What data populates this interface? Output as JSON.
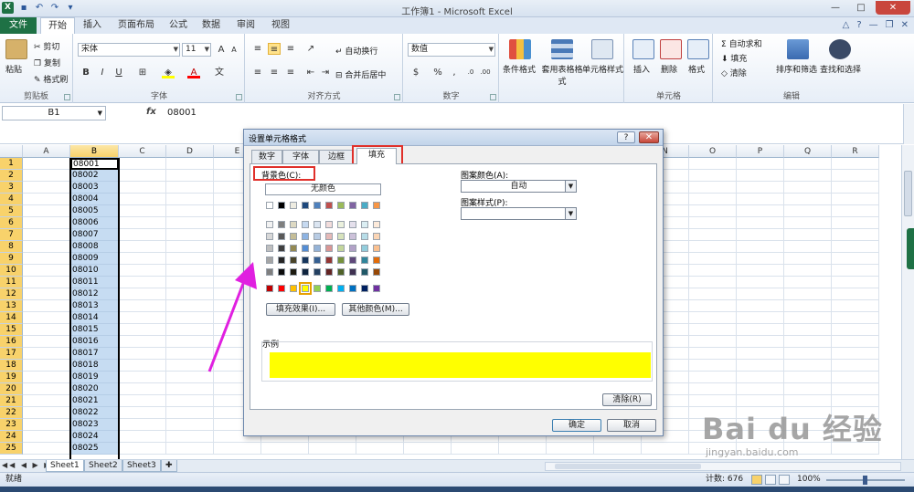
{
  "titlebar": {
    "title": "工作簿1 - Microsoft Excel",
    "app_icon": "X",
    "buttons": [
      "—",
      "□",
      "✕"
    ]
  },
  "ribbon_tabs": {
    "file": "文件",
    "tabs": [
      "开始",
      "插入",
      "页面布局",
      "公式",
      "数据",
      "审阅",
      "视图"
    ]
  },
  "ribbon": {
    "clipboard": {
      "paste": "粘贴",
      "cut": "剪切",
      "copy": "复制",
      "format_painter": "格式刷",
      "label": "剪贴板"
    },
    "font": {
      "font_name": "宋体",
      "font_size": "11",
      "bold": "B",
      "italic": "I",
      "underline": "U",
      "label": "字体"
    },
    "alignment": {
      "wrap": "自动换行",
      "merge": "合并后居中",
      "label": "对齐方式"
    },
    "number": {
      "format": "数值",
      "percent": "%",
      "comma": ",",
      "label": "数字"
    },
    "styles": {
      "conditional": "条件格式",
      "table": "套用表格格式",
      "cell_styles": "单元格样式"
    },
    "cells": {
      "insert": "插入",
      "delete": "删除",
      "format": "格式",
      "label": "单元格"
    },
    "editing": {
      "autosum": "自动求和",
      "fill": "填充",
      "clear": "清除",
      "sort": "排序和筛选",
      "find": "查找和选择",
      "label": "编辑"
    }
  },
  "formula_bar": {
    "name_box": "B1",
    "fx": "fx",
    "value": "08001"
  },
  "grid": {
    "columns": [
      "A",
      "B",
      "C",
      "D",
      "E",
      "F",
      "G",
      "H",
      "I",
      "J",
      "K",
      "L",
      "M",
      "N",
      "O",
      "P",
      "Q",
      "R"
    ],
    "selected_column": "B",
    "rows": [
      "1",
      "2",
      "3",
      "4",
      "5",
      "6",
      "7",
      "8",
      "9",
      "10",
      "11",
      "12",
      "13",
      "14",
      "15",
      "16",
      "17",
      "18",
      "19",
      "20",
      "21",
      "22",
      "23",
      "24",
      "25"
    ],
    "b_values": [
      "08001",
      "08002",
      "08003",
      "08004",
      "08005",
      "08006",
      "08007",
      "08008",
      "08009",
      "08010",
      "08011",
      "08012",
      "08013",
      "08014",
      "08015",
      "08016",
      "08017",
      "08018",
      "08019",
      "08020",
      "08021",
      "08022",
      "08023",
      "08024",
      "08025"
    ]
  },
  "sheets": {
    "tabs": [
      "Sheet1",
      "Sheet2",
      "Sheet3"
    ],
    "active": "Sheet1",
    "nav": "◀◀ ◀ ▶ ▶▶"
  },
  "status": {
    "ready": "就绪",
    "count": "计数: 676",
    "zoom": "100%"
  },
  "dialog": {
    "title": "设置单元格格式",
    "help": "?",
    "close": "✕",
    "tabs": [
      "数字",
      "字体",
      "边框",
      "填充"
    ],
    "active_tab": "填充",
    "background_label": "背景色(C):",
    "no_color": "无颜色",
    "fill_effects": "填充效果(I)...",
    "more_colors": "其他颜色(M)...",
    "pattern_color_label": "图案颜色(A):",
    "pattern_color_value": "自动",
    "pattern_style_label": "图案样式(P):",
    "pattern_style_value": "",
    "sample_label": "示例",
    "clear": "清除(R)",
    "ok": "确定",
    "cancel": "取消",
    "sample_color": "#ffff00",
    "palette_top": [
      "#ffffff",
      "#000000",
      "#eeece1",
      "#1f497d",
      "#4f81bd",
      "#c0504d",
      "#9bbb59",
      "#8064a2",
      "#4bacc6",
      "#f79646"
    ],
    "palette_tints": [
      [
        "#f2f2f2",
        "#7f7f7f",
        "#ddd9c3",
        "#c6d9f0",
        "#dbe5f1",
        "#f2dcdb",
        "#ebf1dd",
        "#e5e0ec",
        "#dbeef3",
        "#fdeada"
      ],
      [
        "#d8d8d8",
        "#595959",
        "#c4bd97",
        "#8db3e2",
        "#b8cce4",
        "#e5b9b7",
        "#d7e3bc",
        "#ccc1d9",
        "#b7dde8",
        "#fbd5b5"
      ],
      [
        "#bfbfbf",
        "#3f3f3f",
        "#938953",
        "#548dd4",
        "#95b3d7",
        "#d99694",
        "#c3d69b",
        "#b2a2c7",
        "#92cddc",
        "#fac08f"
      ],
      [
        "#a5a5a5",
        "#262626",
        "#494429",
        "#17365d",
        "#366092",
        "#953734",
        "#76923c",
        "#5f497a",
        "#31859b",
        "#e36c09"
      ],
      [
        "#7f7f7f",
        "#0c0c0c",
        "#1d1b10",
        "#0f243e",
        "#244061",
        "#632423",
        "#4f6128",
        "#3f3151",
        "#205867",
        "#974806"
      ]
    ],
    "palette_standard": [
      "#c00000",
      "#ff0000",
      "#ffc000",
      "#ffff00",
      "#92d050",
      "#00b050",
      "#00b0f0",
      "#0070c0",
      "#002060",
      "#7030a0"
    ],
    "selected_standard_index": 3
  },
  "watermark": {
    "brand": "Bai du 经验",
    "url": "jingyan.baidu.com"
  }
}
